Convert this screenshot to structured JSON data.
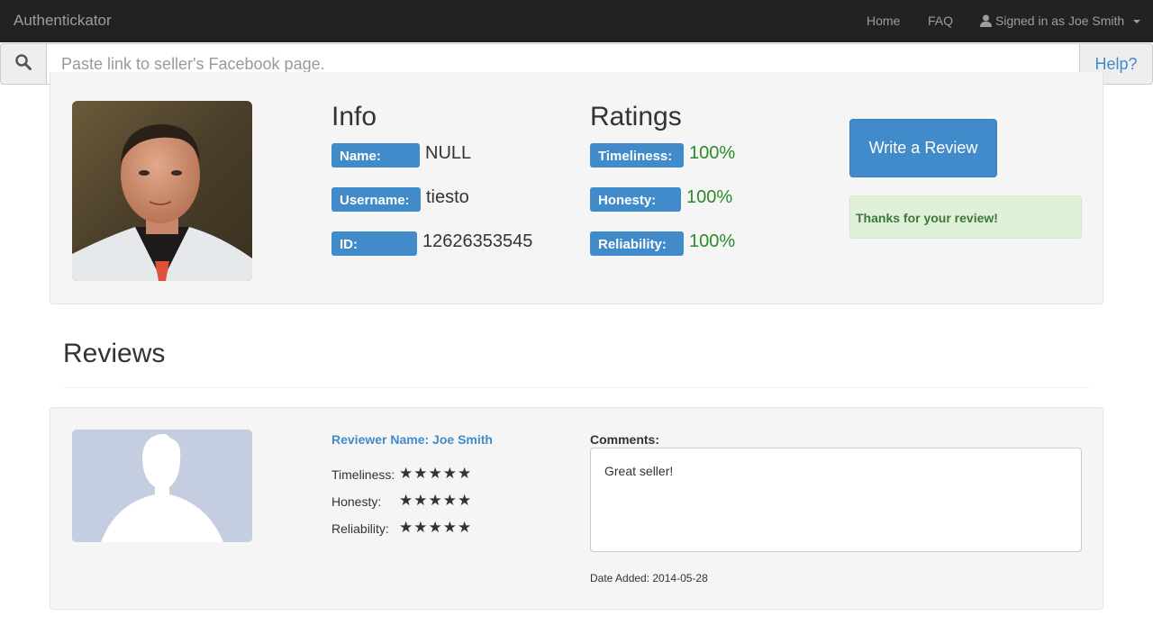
{
  "navbar": {
    "brand": "Authentickator",
    "home": "Home",
    "faq": "FAQ",
    "user": "Signed in as Joe Smith"
  },
  "search": {
    "placeholder": "Paste link to seller's Facebook page.",
    "value": "",
    "help": "Help?"
  },
  "profile": {
    "info_heading": "Info",
    "info": [
      {
        "label": "Name:",
        "value": "NULL"
      },
      {
        "label": "Username:",
        "value": "tiesto"
      },
      {
        "label": "ID:",
        "value": "12626353545"
      }
    ],
    "ratings_heading": "Ratings",
    "ratings": [
      {
        "label": "Timeliness:",
        "value": "100%"
      },
      {
        "label": "Honesty:",
        "value": "100%"
      },
      {
        "label": "Reliability:",
        "value": "100%"
      }
    ],
    "write_review": "Write a Review",
    "alert": "Thanks for your review!"
  },
  "reviews": {
    "heading": "Reviews",
    "items": [
      {
        "reviewer": "Reviewer Name: Joe Smith",
        "ratings": [
          {
            "label": "Timeliness:",
            "stars": "★★★★★",
            "score": 5
          },
          {
            "label": "Honesty:",
            "stars": "★★★★★",
            "score": 5
          },
          {
            "label": "Reliability:",
            "stars": "★★★★★",
            "score": 5
          }
        ],
        "comments_label": "Comments:",
        "comment": "Great seller!",
        "date": "Date Added: 2014-05-28"
      }
    ]
  },
  "colors": {
    "primary": "#428bca",
    "navbar": "#222222",
    "success_text": "#2a8a2a",
    "alert_bg": "#dff0d8"
  },
  "icons": {
    "search": "search-icon",
    "user": "user-icon",
    "caret": "caret-down-icon"
  }
}
